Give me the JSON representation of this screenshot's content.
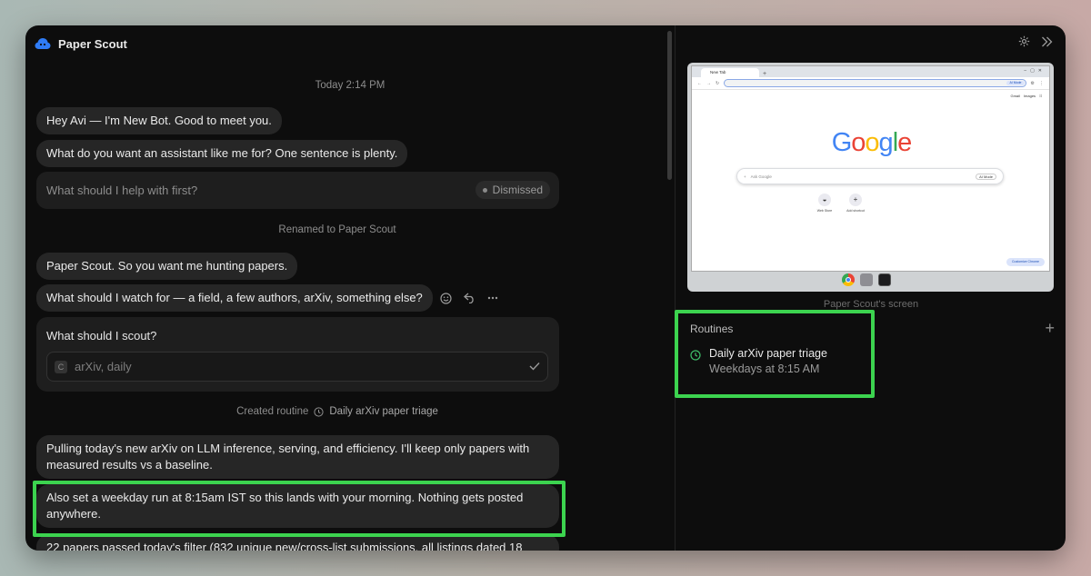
{
  "app": {
    "title": "Paper Scout"
  },
  "chat": {
    "timestamp": "Today 2:14 PM",
    "msg1": "Hey Avi — I'm New Bot. Good to meet you.",
    "msg2": "What do you want an assistant like me for? One sentence is plenty.",
    "question1": {
      "text": "What should I help with first?",
      "status": "Dismissed"
    },
    "rename_note": "Renamed to Paper Scout",
    "msg3": "Paper Scout. So you want me hunting papers.",
    "msg4": "What should I watch for — a field, a few authors, arXiv, something else?",
    "question2": {
      "title": "What should I scout?",
      "answer": "arXiv, daily",
      "badge": "C"
    },
    "routine_note": {
      "prefix": "Created routine",
      "name": "Daily arXiv paper triage"
    },
    "msg5": "Pulling today's new arXiv on LLM inference, serving, and efficiency. I'll keep only papers with measured results vs a baseline.",
    "msg6": "Also set a weekday run at 8:15am IST so this lands with your morning. Nothing gets posted anywhere.",
    "msg7": "22 papers passed today's filter (832 unique new/cross-list submissions, all listings dated 18"
  },
  "panel": {
    "screen_label": "Paper Scout's screen",
    "routines_title": "Routines",
    "add_label": "+",
    "routine": {
      "name": "Daily arXiv paper triage",
      "schedule": "Weekdays at 8:15 AM"
    }
  },
  "browser": {
    "tab_title": "New Tab",
    "ai_mode": "AI Mode",
    "links": [
      "Gmail",
      "Images"
    ],
    "logo_letters": [
      "G",
      "o",
      "o",
      "g",
      "l",
      "e"
    ],
    "search_placeholder": "Ask Google",
    "search_mode": "AI Mode",
    "shortcuts": [
      "Web Store",
      "Add shortcut"
    ],
    "customize": "Customize Chrome"
  },
  "colors": {
    "highlight": "#3cd34f",
    "accent_blue": "#2f7cf6",
    "routine_icon": "#3fbf6a"
  }
}
